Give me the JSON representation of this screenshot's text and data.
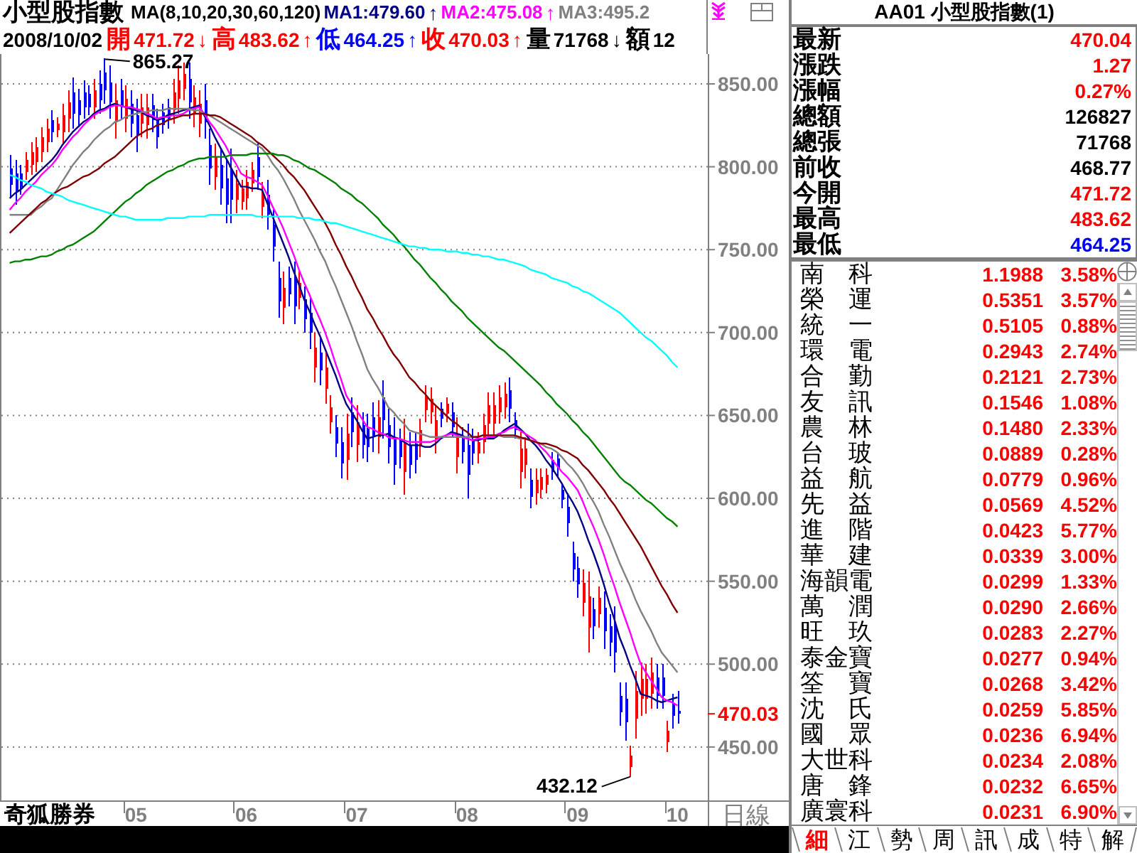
{
  "chart_header": {
    "title": "小型股指數",
    "ma_label": "MA(8,10,20,30,60,120)",
    "ma_legend": [
      {
        "label": "MA1:479.60",
        "arrow": "↑"
      },
      {
        "label": "MA2:475.08",
        "arrow": "↑"
      },
      {
        "label": "MA3:495.2"
      }
    ],
    "date": "2008/10/02",
    "quote": [
      {
        "label": "開",
        "value": "471.72",
        "arrow": "↓",
        "color": "#ff0000"
      },
      {
        "label": "高",
        "value": "483.62",
        "arrow": "↑",
        "color": "#ff0000"
      },
      {
        "label": "低",
        "value": "464.25",
        "arrow": "↑",
        "color": "#0000ff"
      },
      {
        "label": "收",
        "value": "470.03",
        "arrow": "↑",
        "color": "#ff0000"
      },
      {
        "label": "量",
        "value": "71768",
        "arrow": "↓",
        "color": "#000000"
      },
      {
        "label": "額",
        "value": "12",
        "color": "#000000"
      }
    ]
  },
  "chart": {
    "brand": "奇狐勝券",
    "period": "日線",
    "chart_data": {
      "type": "line",
      "grid": true,
      "ylim": [
        417.8,
        868
      ],
      "categories": [
        null,
        null,
        null,
        null,
        null,
        null,
        null,
        null,
        null,
        null,
        null,
        null,
        null,
        null,
        null,
        null,
        null,
        null,
        null,
        null,
        null,
        null,
        null,
        null,
        "05",
        null,
        null,
        null,
        null,
        null,
        null,
        null,
        null,
        null,
        null,
        null,
        null,
        null,
        null,
        null,
        null,
        null,
        null,
        null,
        null,
        "06",
        null,
        null,
        null,
        null,
        null,
        null,
        null,
        null,
        null,
        null,
        null,
        null,
        null,
        null,
        null,
        null,
        null,
        null,
        null,
        null,
        "07",
        null,
        null,
        null,
        null,
        null,
        null,
        null,
        null,
        null,
        null,
        null,
        null,
        null,
        null,
        null,
        null,
        null,
        null,
        null,
        null,
        "08",
        null,
        null,
        null,
        null,
        null,
        null,
        null,
        null,
        null,
        null,
        null,
        null,
        null,
        null,
        null,
        null,
        null,
        null,
        null,
        null,
        "09",
        null,
        null,
        null,
        null,
        null,
        null,
        null,
        null,
        null,
        null,
        null,
        null,
        null,
        null,
        null,
        null,
        null,
        null,
        "10"
      ],
      "yticks": [
        {
          "value": 450,
          "label": "450.00"
        },
        {
          "value": 500,
          "label": "500.00"
        },
        {
          "value": 550,
          "label": "550.00"
        },
        {
          "value": 600,
          "label": "600.00"
        },
        {
          "value": 650,
          "label": "650.00"
        },
        {
          "value": 700,
          "label": "700.00"
        },
        {
          "value": 750,
          "label": "750.00"
        },
        {
          "value": 800,
          "label": "800.00"
        },
        {
          "value": 850,
          "label": "850.00"
        }
      ],
      "series": [
        {
          "color": "#000080",
          "values": [
            781,
            784,
            786,
            789,
            792,
            795,
            798,
            801,
            804,
            808,
            813,
            817,
            821,
            824,
            827,
            829,
            832,
            834,
            835,
            837,
            838,
            837,
            836,
            835,
            834,
            833,
            831,
            830,
            828,
            829,
            831,
            832,
            833,
            834,
            835,
            836,
            837,
            831,
            825,
            818,
            812,
            806,
            800,
            794,
            788,
            788,
            787,
            787,
            786,
            778,
            770,
            762,
            754,
            746,
            737,
            729,
            720,
            713,
            705,
            698,
            690,
            682,
            674,
            665,
            657,
            652,
            647,
            641,
            636,
            637,
            638,
            638,
            639,
            637,
            636,
            634,
            632,
            632,
            632,
            631,
            631,
            633,
            636,
            638,
            640,
            639,
            638,
            636,
            635,
            635,
            636,
            636,
            636,
            638,
            641,
            643,
            645,
            642,
            639,
            635,
            632,
            628,
            623,
            619,
            614,
            609,
            603,
            598,
            592,
            584,
            575,
            567,
            558,
            548,
            537,
            527,
            516,
            508,
            499,
            491,
            482,
            481,
            480,
            478,
            477,
            478,
            479,
            480
          ]
        },
        {
          "color": "#ff00ff",
          "values": [
            774,
            778,
            781,
            785,
            788,
            791,
            795,
            798,
            801,
            805,
            810,
            814,
            818,
            821,
            825,
            828,
            831,
            833,
            834,
            836,
            837,
            837,
            836,
            836,
            835,
            834,
            832,
            831,
            829,
            830,
            830,
            831,
            831,
            832,
            834,
            835,
            836,
            832,
            827,
            823,
            818,
            813,
            807,
            802,
            796,
            794,
            793,
            791,
            789,
            783,
            776,
            770,
            763,
            755,
            747,
            738,
            730,
            723,
            715,
            708,
            700,
            691,
            681,
            672,
            662,
            657,
            653,
            648,
            643,
            642,
            640,
            639,
            637,
            636,
            636,
            635,
            634,
            634,
            634,
            634,
            634,
            635,
            637,
            638,
            639,
            638,
            637,
            636,
            635,
            636,
            636,
            637,
            637,
            639,
            640,
            642,
            643,
            641,
            639,
            637,
            635,
            631,
            628,
            624,
            620,
            616,
            613,
            609,
            605,
            598,
            590,
            583,
            575,
            566,
            556,
            547,
            537,
            528,
            519,
            509,
            500,
            495,
            490,
            485,
            480,
            478,
            477,
            475
          ]
        },
        {
          "color": "#808080",
          "values": [
            771,
            771,
            771,
            771,
            771,
            774,
            776,
            779,
            781,
            786,
            791,
            796,
            801,
            805,
            809,
            812,
            816,
            819,
            822,
            824,
            827,
            828,
            830,
            831,
            832,
            833,
            833,
            834,
            834,
            834,
            835,
            835,
            835,
            835,
            835,
            834,
            834,
            832,
            831,
            829,
            827,
            825,
            823,
            821,
            819,
            817,
            815,
            813,
            811,
            807,
            802,
            798,
            793,
            787,
            781,
            774,
            768,
            762,
            756,
            749,
            743,
            735,
            728,
            720,
            712,
            704,
            695,
            687,
            678,
            672,
            667,
            661,
            655,
            652,
            648,
            645,
            641,
            640,
            639,
            638,
            637,
            637,
            637,
            637,
            637,
            637,
            637,
            637,
            637,
            637,
            638,
            638,
            638,
            638,
            637,
            637,
            637,
            636,
            636,
            635,
            634,
            633,
            631,
            630,
            628,
            625,
            621,
            618,
            614,
            609,
            603,
            598,
            592,
            584,
            577,
            569,
            561,
            554,
            547,
            539,
            532,
            526,
            520,
            513,
            507,
            503,
            499,
            495
          ]
        },
        {
          "color": "#800000",
          "values": [
            760,
            763,
            766,
            769,
            772,
            775,
            778,
            780,
            783,
            785,
            787,
            788,
            790,
            792,
            794,
            795,
            797,
            799,
            802,
            804,
            806,
            809,
            812,
            815,
            818,
            820,
            822,
            823,
            825,
            826,
            828,
            829,
            830,
            831,
            831,
            832,
            832,
            832,
            831,
            831,
            830,
            828,
            826,
            824,
            822,
            820,
            818,
            815,
            813,
            810,
            807,
            804,
            801,
            797,
            794,
            790,
            786,
            781,
            776,
            771,
            766,
            760,
            753,
            747,
            740,
            734,
            727,
            721,
            714,
            709,
            703,
            698,
            692,
            687,
            683,
            678,
            673,
            670,
            666,
            663,
            659,
            656,
            653,
            650,
            647,
            645,
            642,
            640,
            637,
            637,
            638,
            638,
            638,
            638,
            638,
            638,
            638,
            637,
            636,
            635,
            634,
            633,
            633,
            632,
            631,
            629,
            628,
            626,
            624,
            620,
            617,
            613,
            609,
            605,
            600,
            596,
            591,
            586,
            581,
            576,
            571,
            565,
            559,
            553,
            547,
            542,
            536,
            531
          ]
        },
        {
          "color": "#008000",
          "values": [
            742,
            743,
            743,
            744,
            744,
            745,
            746,
            746,
            747,
            749,
            750,
            752,
            753,
            755,
            757,
            759,
            761,
            764,
            767,
            770,
            773,
            776,
            779,
            781,
            784,
            786,
            789,
            791,
            793,
            795,
            797,
            798,
            800,
            801,
            803,
            804,
            805,
            805,
            806,
            806,
            806,
            806,
            807,
            807,
            807,
            807,
            808,
            808,
            808,
            808,
            808,
            807,
            807,
            806,
            804,
            803,
            801,
            799,
            798,
            796,
            794,
            792,
            790,
            787,
            785,
            783,
            780,
            778,
            775,
            772,
            769,
            765,
            762,
            759,
            755,
            752,
            748,
            744,
            741,
            737,
            733,
            730,
            726,
            723,
            719,
            716,
            713,
            709,
            706,
            703,
            700,
            697,
            694,
            691,
            689,
            686,
            683,
            680,
            677,
            674,
            671,
            668,
            664,
            661,
            657,
            654,
            651,
            647,
            644,
            640,
            637,
            633,
            629,
            625,
            621,
            617,
            613,
            610,
            608,
            605,
            602,
            599,
            597,
            594,
            591,
            588,
            586,
            583
          ]
        },
        {
          "color": "#00ffff",
          "values": [
            795,
            794,
            792,
            791,
            789,
            788,
            787,
            785,
            784,
            783,
            782,
            780,
            779,
            778,
            777,
            776,
            775,
            774,
            773,
            772,
            771,
            770,
            770,
            769,
            768,
            768,
            768,
            768,
            768,
            768,
            769,
            769,
            769,
            769,
            770,
            770,
            770,
            770,
            771,
            771,
            771,
            771,
            771,
            771,
            771,
            771,
            771,
            770,
            770,
            770,
            770,
            770,
            770,
            770,
            770,
            769,
            769,
            769,
            768,
            768,
            767,
            766,
            766,
            765,
            764,
            763,
            762,
            761,
            760,
            759,
            758,
            757,
            756,
            755,
            754,
            753,
            752,
            752,
            751,
            751,
            750,
            750,
            750,
            749,
            749,
            749,
            748,
            748,
            747,
            747,
            746,
            746,
            745,
            744,
            744,
            743,
            742,
            741,
            740,
            738,
            737,
            736,
            735,
            733,
            732,
            731,
            730,
            728,
            727,
            725,
            724,
            722,
            720,
            718,
            716,
            714,
            712,
            709,
            706,
            703,
            700,
            697,
            695,
            692,
            689,
            686,
            682,
            679
          ]
        },
        {
          "type": "candlestick",
          "ohlc": [
            [
              799,
              807,
              781,
              789
            ],
            [
              796,
              804,
              777,
              785
            ],
            [
              796,
              801,
              783,
              788
            ],
            [
              797,
              809,
              792,
              804
            ],
            [
              801,
              815,
              795,
              809
            ],
            [
              803,
              818,
              797,
              812
            ],
            [
              809,
              824,
              803,
              818
            ],
            [
              815,
              829,
              809,
              823
            ],
            [
              828,
              834,
              815,
              821
            ],
            [
              822,
              830,
              818,
              826
            ],
            [
              821,
              838,
              814,
              831
            ],
            [
              829,
              846,
              821,
              839
            ],
            [
              845,
              854,
              823,
              832
            ],
            [
              840,
              847,
              824,
              831
            ],
            [
              845,
              852,
              829,
              836
            ],
            [
              844,
              849,
              831,
              836
            ],
            [
              836,
              853,
              829,
              846
            ],
            [
              850,
              858,
              832,
              840
            ],
            [
              857,
              865.27,
              838,
              846
            ],
            [
              851,
              861,
              829,
              839
            ],
            [
              827,
              850,
              817,
              840
            ],
            [
              846,
              853,
              829,
              836
            ],
            [
              829,
              849,
              821,
              841
            ],
            [
              838,
              846,
              818,
              826
            ],
            [
              831,
              841,
              809,
              819
            ],
            [
              826,
              844,
              818,
              836
            ],
            [
              825,
              844,
              817,
              836
            ],
            [
              837,
              844,
              821,
              828
            ],
            [
              828,
              835,
              811,
              818
            ],
            [
              833,
              838,
              820,
              825
            ],
            [
              836,
              841,
              823,
              828
            ],
            [
              834,
              853,
              826,
              845
            ],
            [
              841,
              861,
              832,
              852
            ],
            [
              847,
              863,
              840,
              856
            ],
            [
              853,
              863,
              829,
              839
            ],
            [
              832,
              849,
              824,
              842
            ],
            [
              826,
              846,
              818,
              838
            ],
            [
              840,
              850,
              817,
              827
            ],
            [
              813,
              823,
              789,
              799
            ],
            [
              794,
              814,
              786,
              806
            ],
            [
              801,
              811,
              777,
              787
            ],
            [
              793,
              804,
              766,
              777
            ],
            [
              798,
              811,
              766,
              780
            ],
            [
              780,
              798,
              772,
              790
            ],
            [
              779,
              792,
              774,
              787
            ],
            [
              781,
              798,
              774,
              791
            ],
            [
              790,
              803,
              785,
              798
            ],
            [
              806,
              814,
              786,
              794
            ],
            [
              776,
              791,
              769,
              784
            ],
            [
              783,
              792,
              762,
              771
            ],
            [
              765,
              774,
              743,
              752
            ],
            [
              733,
              743,
              709,
              719
            ],
            [
              715,
              737,
              705,
              727
            ],
            [
              733,
              740,
              716,
              723
            ],
            [
              732,
              743,
              705,
              716
            ],
            [
              721,
              737,
              714,
              730
            ],
            [
              720,
              728,
              700,
              708
            ],
            [
              712,
              722,
              690,
              700
            ],
            [
              679,
              700,
              670,
              691
            ],
            [
              688,
              697,
              668,
              677
            ],
            [
              666,
              688,
              657,
              679
            ],
            [
              646,
              662,
              639,
              655
            ],
            [
              643,
              650,
              625,
              633
            ],
            [
              634,
              643,
              612,
              621
            ],
            [
              623,
              651,
              611,
              639
            ],
            [
              652,
              661,
              631,
              640
            ],
            [
              632,
              656,
              622,
              646
            ],
            [
              644,
              652,
              624,
              632
            ],
            [
              642,
              651,
              622,
              631
            ],
            [
              649,
              658,
              628,
              637
            ],
            [
              637,
              659,
              627,
              649
            ],
            [
              661,
              671,
              636,
              647
            ],
            [
              644,
              654,
              621,
              631
            ],
            [
              637,
              649,
              608,
              620
            ],
            [
              635,
              642,
              618,
              625
            ],
            [
              616,
              648,
              602,
              634
            ],
            [
              632,
              640,
              612,
              620
            ],
            [
              633,
              640,
              615,
              623
            ],
            [
              632,
              648,
              625,
              641
            ],
            [
              653,
              668,
              646,
              661
            ],
            [
              652,
              667,
              645,
              660
            ],
            [
              636,
              656,
              627,
              647
            ],
            [
              654,
              658,
              643,
              648
            ],
            [
              651,
              661,
              646,
              657
            ],
            [
              652,
              658,
              637,
              643
            ],
            [
              625,
              649,
              615,
              639
            ],
            [
              636,
              643,
              621,
              628
            ],
            [
              632,
              645,
              600,
              614
            ],
            [
              635,
              642,
              620,
              627
            ],
            [
              627,
              640,
              621,
              634
            ],
            [
              634,
              651,
              627,
              644
            ],
            [
              645,
              664,
              637,
              656
            ],
            [
              645,
              664,
              637,
              656
            ],
            [
              652,
              668,
              645,
              661
            ],
            [
              655,
              670,
              648,
              663
            ],
            [
              665,
              673,
              646,
              654
            ],
            [
              647,
              652,
              636,
              641
            ],
            [
              616,
              640,
              606,
              630
            ],
            [
              620,
              637,
              612,
              630
            ],
            [
              611,
              618,
              594,
              601
            ],
            [
              603,
              618,
              596,
              611
            ],
            [
              605,
              618,
              600,
              613
            ],
            [
              608,
              618,
              603,
              614
            ],
            [
              623,
              628,
              611,
              616
            ],
            [
              624,
              628,
              613,
              618
            ],
            [
              605,
              609,
              594,
              599
            ],
            [
              595,
              603,
              577,
              585
            ],
            [
              567,
              574,
              550,
              557
            ],
            [
              558,
              565,
              540,
              548
            ],
            [
              537,
              557,
              529,
              549
            ],
            [
              522,
              556,
              507,
              541
            ],
            [
              533,
              540,
              515,
              523
            ],
            [
              530,
              547,
              522,
              540
            ],
            [
              534,
              544,
              509,
              520
            ],
            [
              523,
              530,
              505,
              513
            ],
            [
              523,
              535,
              495,
              507
            ],
            [
              481,
              489,
              463,
              471
            ],
            [
              479,
              489,
              454,
              465
            ],
            [
              438,
              451,
              432.12,
              445
            ],
            [
              467,
              496,
              455,
              484
            ],
            [
              479,
              501,
              469,
              491
            ],
            [
              479,
              500,
              470,
              491
            ],
            [
              482,
              504,
              473,
              495
            ],
            [
              492,
              500,
              473,
              481
            ],
            [
              492,
              500,
              473,
              481
            ],
            [
              453,
              466,
              447,
              460
            ],
            [
              476,
              482,
              461,
              468.77
            ],
            [
              471.72,
              483.62,
              464.25,
              470.03
            ]
          ]
        }
      ],
      "annotations": [
        "865.27",
        "432.12",
        "470.03"
      ]
    }
  },
  "quote_panel": {
    "title": "AA01 小型股指數(1)",
    "rows": [
      {
        "label": "最新",
        "value": "470.04",
        "color": "#ff0000"
      },
      {
        "label": "漲跌",
        "value": "1.27",
        "color": "#ff0000"
      },
      {
        "label": "漲幅",
        "value": "0.27%",
        "color": "#ff0000"
      },
      {
        "label": "總額",
        "value": "126827",
        "color": "#000000"
      },
      {
        "label": "總張",
        "value": "71768",
        "color": "#000000"
      },
      {
        "label": "前收",
        "value": "468.77",
        "color": "#000000"
      },
      {
        "label": "今開",
        "value": "471.72",
        "color": "#ff0000"
      },
      {
        "label": "最高",
        "value": "483.62",
        "color": "#ff0000"
      },
      {
        "label": "最低",
        "value": "464.25",
        "color": "#0000ff"
      }
    ]
  },
  "stock_list": {
    "rows": [
      {
        "column_1": "南　科",
        "column_2": "1.1988",
        "column_3": "3.58%"
      },
      {
        "column_1": "榮　運",
        "column_2": "0.5351",
        "column_3": "3.57%"
      },
      {
        "column_1": "統　一",
        "column_2": "0.5105",
        "column_3": "0.88%"
      },
      {
        "column_1": "環　電",
        "column_2": "0.2943",
        "column_3": "2.74%"
      },
      {
        "column_1": "合　勤",
        "column_2": "0.2121",
        "column_3": "2.73%"
      },
      {
        "column_1": "友　訊",
        "column_2": "0.1546",
        "column_3": "1.08%"
      },
      {
        "column_1": "農　林",
        "column_2": "0.1480",
        "column_3": "2.33%"
      },
      {
        "column_1": "台　玻",
        "column_2": "0.0889",
        "column_3": "0.28%"
      },
      {
        "column_1": "益　航",
        "column_2": "0.0779",
        "column_3": "0.96%"
      },
      {
        "column_1": "先　益",
        "column_2": "0.0569",
        "column_3": "4.52%"
      },
      {
        "column_1": "進　階",
        "column_2": "0.0423",
        "column_3": "5.77%"
      },
      {
        "column_1": "華　建",
        "column_2": "0.0339",
        "column_3": "3.00%"
      },
      {
        "column_1": "海韻電",
        "column_2": "0.0299",
        "column_3": "1.33%"
      },
      {
        "column_1": "萬　潤",
        "column_2": "0.0290",
        "column_3": "2.66%"
      },
      {
        "column_1": "旺　玖",
        "column_2": "0.0283",
        "column_3": "2.27%"
      },
      {
        "column_1": "泰金寶",
        "column_2": "0.0277",
        "column_3": "0.94%"
      },
      {
        "column_1": "筌　寶",
        "column_2": "0.0268",
        "column_3": "3.42%"
      },
      {
        "column_1": "沈　氏",
        "column_2": "0.0259",
        "column_3": "5.85%"
      },
      {
        "column_1": "國　眾",
        "column_2": "0.0236",
        "column_3": "6.94%"
      },
      {
        "column_1": "大世科",
        "column_2": "0.0234",
        "column_3": "2.08%"
      },
      {
        "column_1": "唐　鋒",
        "column_2": "0.0232",
        "column_3": "6.65%"
      },
      {
        "column_1": "廣寰科",
        "column_2": "0.0231",
        "column_3": "6.90%"
      }
    ]
  },
  "tabs": [
    {
      "label": "細",
      "selected": true
    },
    {
      "label": "江",
      "selected": false
    },
    {
      "label": "勢",
      "selected": false
    },
    {
      "label": "周",
      "selected": false
    },
    {
      "label": "訊",
      "selected": false
    },
    {
      "label": "成",
      "selected": false
    },
    {
      "label": "特",
      "selected": false
    },
    {
      "label": "解",
      "selected": false
    }
  ]
}
